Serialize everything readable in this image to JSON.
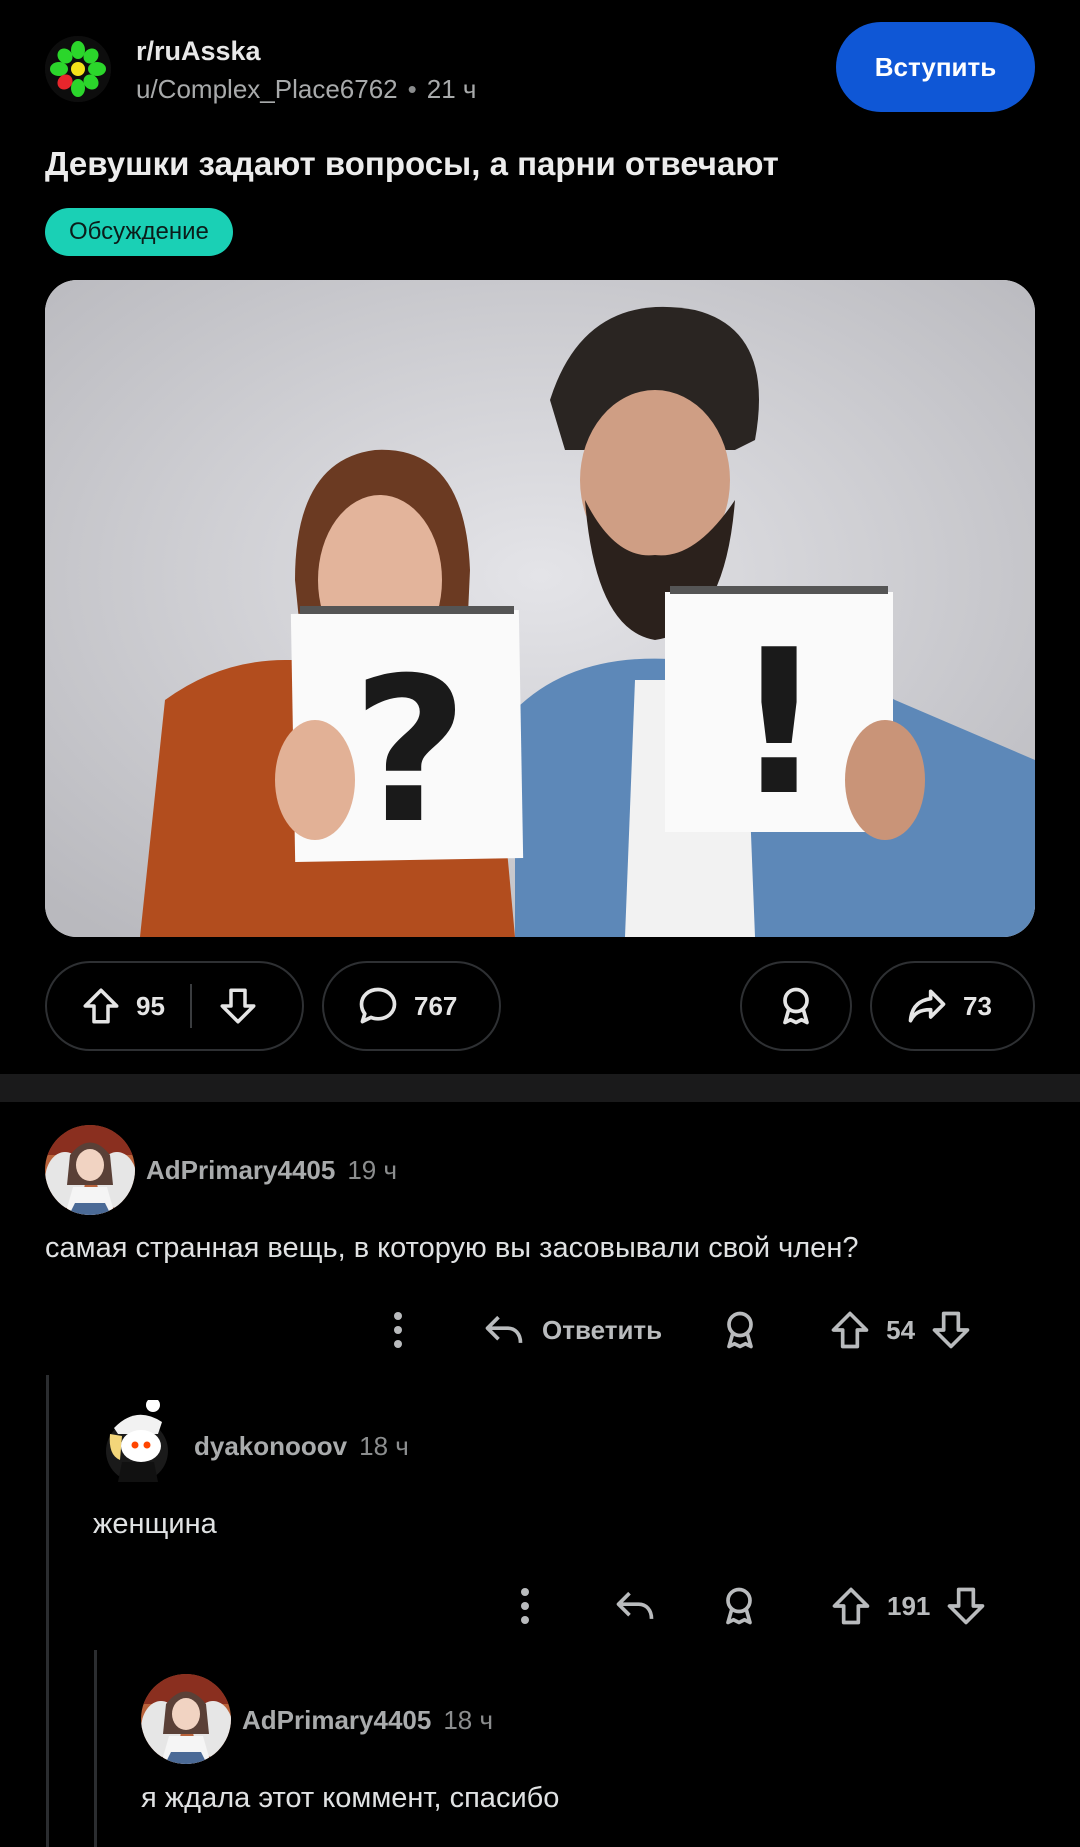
{
  "post": {
    "subreddit": "r/ruAsska",
    "author": "u/Complex_Place6762",
    "time": "21 ч",
    "join_label": "Вступить",
    "title": "Девушки задают вопросы, а парни отвечают",
    "flair": "Обсуждение",
    "upvotes": "95",
    "comments": "767",
    "shares": "73"
  },
  "comments": [
    {
      "user": "AdPrimary4405",
      "time": "19 ч",
      "text": "самая странная вещь, в которую вы засовывали свой член?",
      "reply_label": "Ответить",
      "score": "54"
    },
    {
      "user": "dyakonooov",
      "time": "18 ч",
      "text": "женщина",
      "score": "191"
    },
    {
      "user": "AdPrimary4405",
      "time": "18 ч",
      "text": "я ждала этот коммент, спасибо"
    }
  ],
  "colors": {
    "join": "#0f57d6",
    "flair": "#1ad0b5",
    "background": "#000000"
  }
}
